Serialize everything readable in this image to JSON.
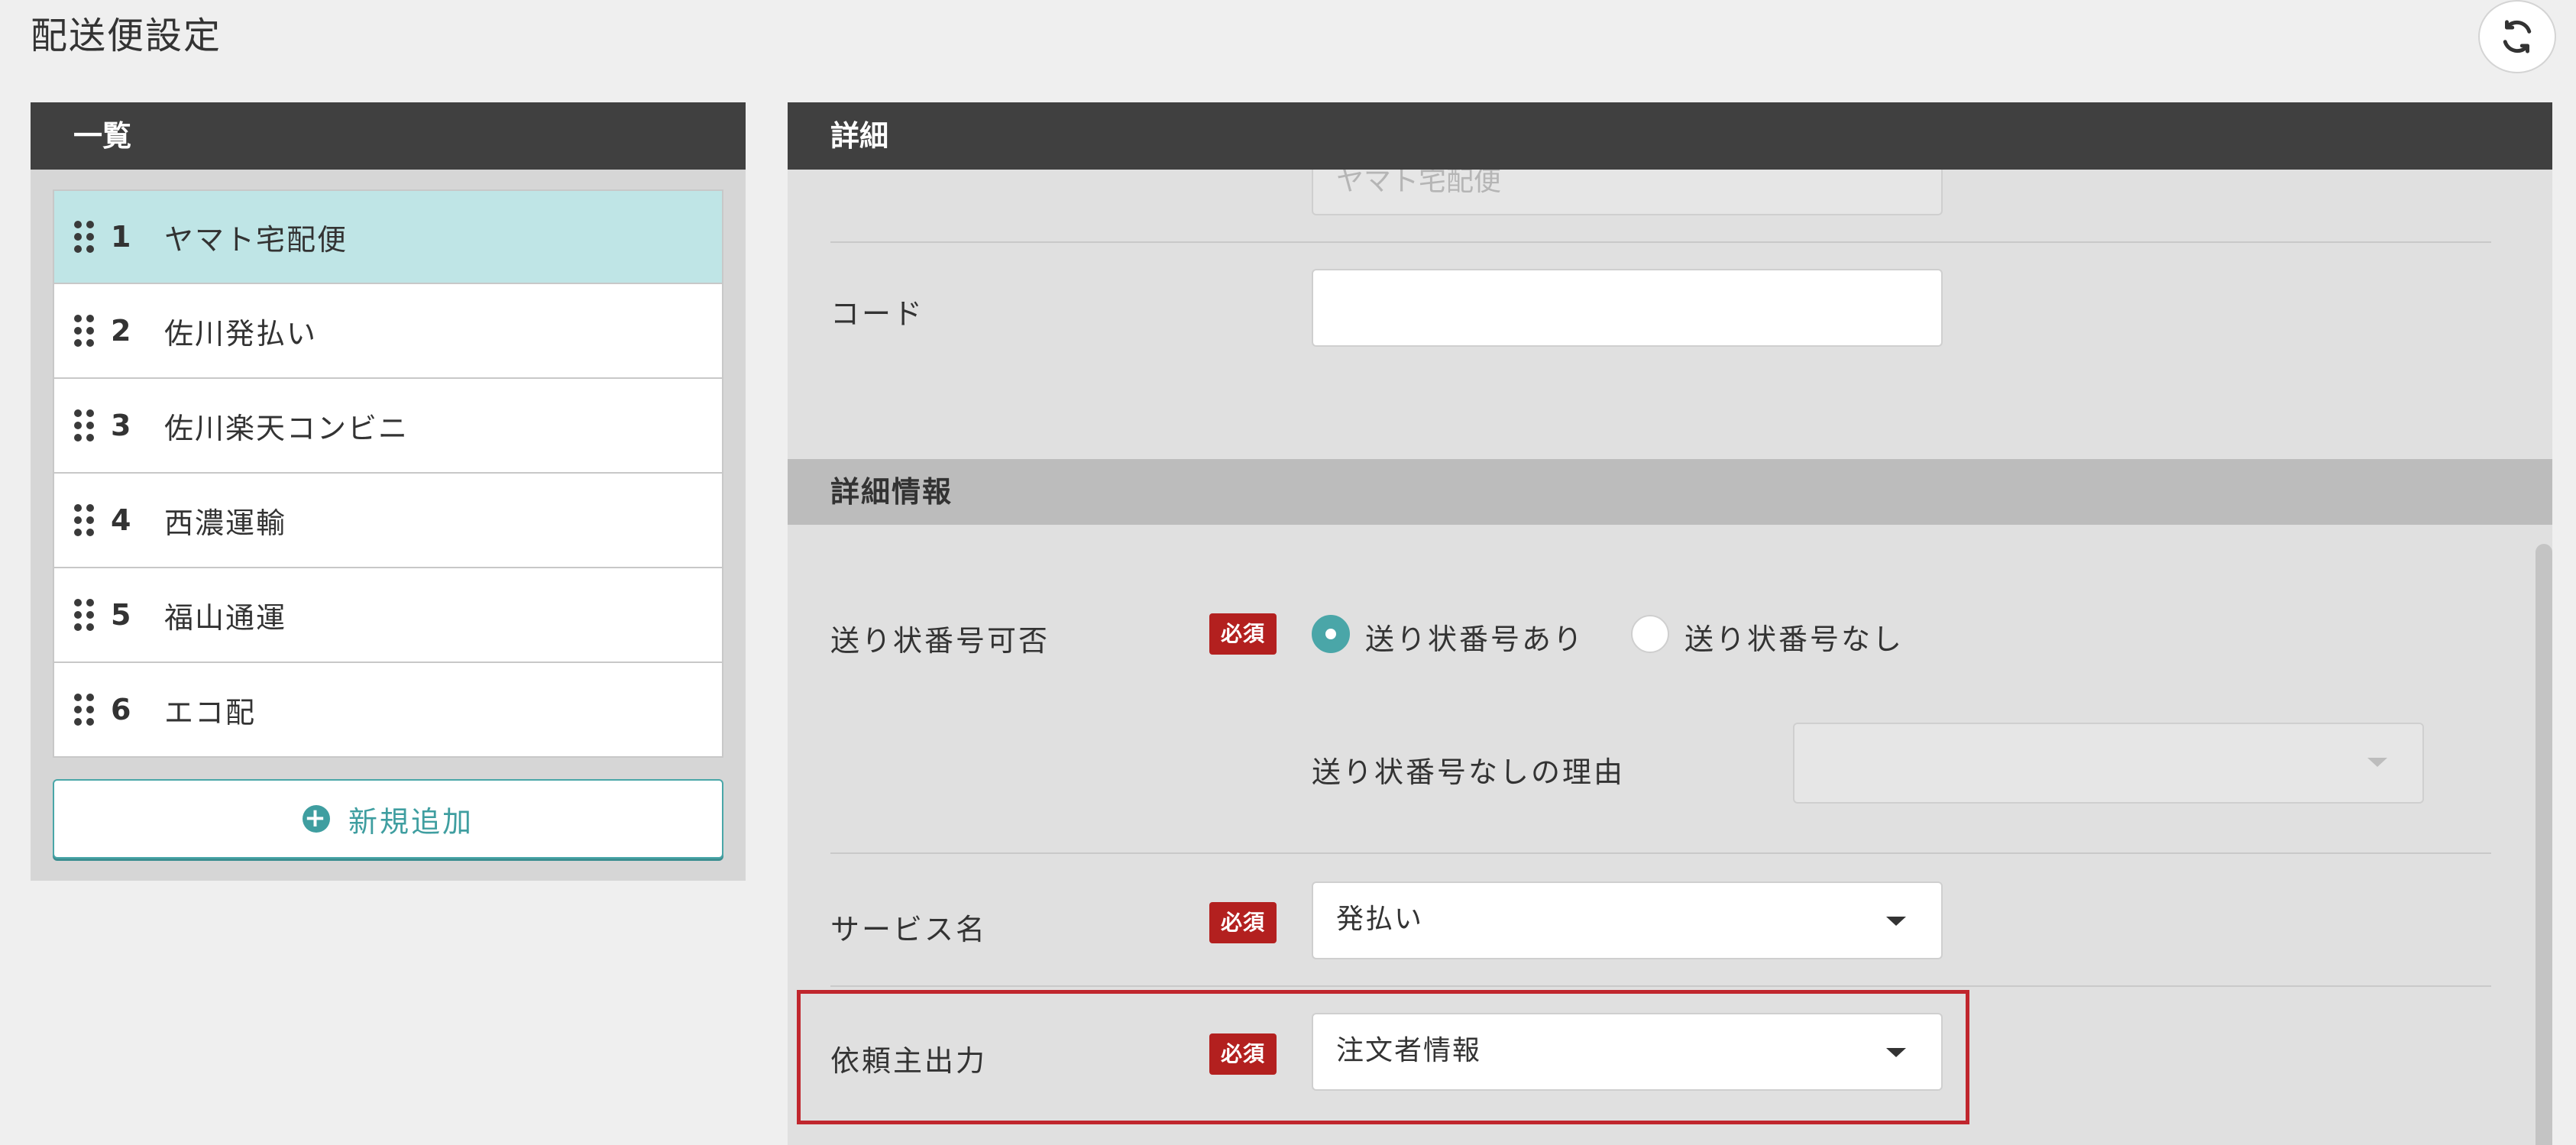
{
  "page": {
    "title": "配送便設定",
    "refresh_icon": "refresh-icon"
  },
  "list_panel": {
    "header": "一覧",
    "items": [
      {
        "num": "1",
        "label": "ヤマト宅配便",
        "selected": true
      },
      {
        "num": "2",
        "label": "佐川発払い",
        "selected": false
      },
      {
        "num": "3",
        "label": "佐川楽天コンビニ",
        "selected": false
      },
      {
        "num": "4",
        "label": "西濃運輸",
        "selected": false
      },
      {
        "num": "5",
        "label": "福山通運",
        "selected": false
      },
      {
        "num": "6",
        "label": "エコ配",
        "selected": false
      }
    ],
    "add_button": "新規追加"
  },
  "detail_panel": {
    "header": "詳細",
    "name_field": {
      "value": "ヤマト宅配便"
    },
    "code_field": {
      "label": "コード",
      "value": ""
    },
    "section_title": "詳細情報",
    "required_badge": "必須",
    "tracking": {
      "label": "送り状番号可否",
      "option_yes": "送り状番号あり",
      "option_no": "送り状番号なし",
      "selected": "送り状番号あり",
      "reason_label": "送り状番号なしの理由",
      "reason_value": ""
    },
    "service": {
      "label": "サービス名",
      "value": "発払い"
    },
    "requester": {
      "label": "依頼主出力",
      "value": "注文者情報"
    }
  },
  "colors": {
    "header_bg": "#404040",
    "accent": "#4aa6a8",
    "selected_row": "#bfe5e6",
    "required_badge": "#b3201f",
    "highlight_border": "#c0262d"
  }
}
